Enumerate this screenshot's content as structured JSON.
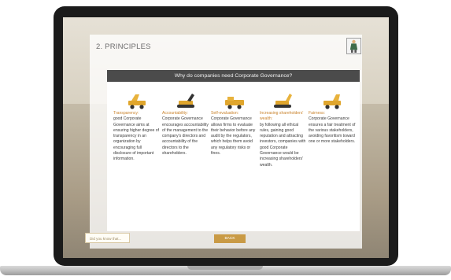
{
  "page": {
    "title": "2. PRINCIPLES"
  },
  "dialog": {
    "heading": "Why do companies need Corporate Governance?",
    "columns": [
      {
        "heading": "Transparency:",
        "body": "good Corporate Governance aims at ensuring higher degree of transparency in an organization by encouraging full disclosure of important information."
      },
      {
        "heading": "Accountability:",
        "body": "Corporate Governance encourages accountability of the management to the company's directors and accountability of the directors to the shareholders."
      },
      {
        "heading": "Self-evaluation:",
        "body": "Corporate Governance allows firms to evaluate their behavior before any audit by the regulators, which helps them avoid any regulatory risks or fines."
      },
      {
        "heading": "Increasing shareholders' wealth:",
        "body": "by following all ethical rules, gaining good reputation and attracting investors, companies with good Corporate Governance would be increasing shareholders' wealth."
      },
      {
        "heading": "Fairness:",
        "body": "Corporate Governance ensures a fair treatment of the various stakeholders, avoiding favoritism toward one or more stakeholders."
      }
    ]
  },
  "buttons": {
    "did_you_know": "Did you know that...",
    "back": "BACK"
  },
  "icons": {
    "column_icon": "construction-machine-icon",
    "corner_icon": "character-icon"
  },
  "colors": {
    "accent": "#c9822b",
    "header_bar": "#4b4b4b",
    "back_button": "#c99a45"
  }
}
